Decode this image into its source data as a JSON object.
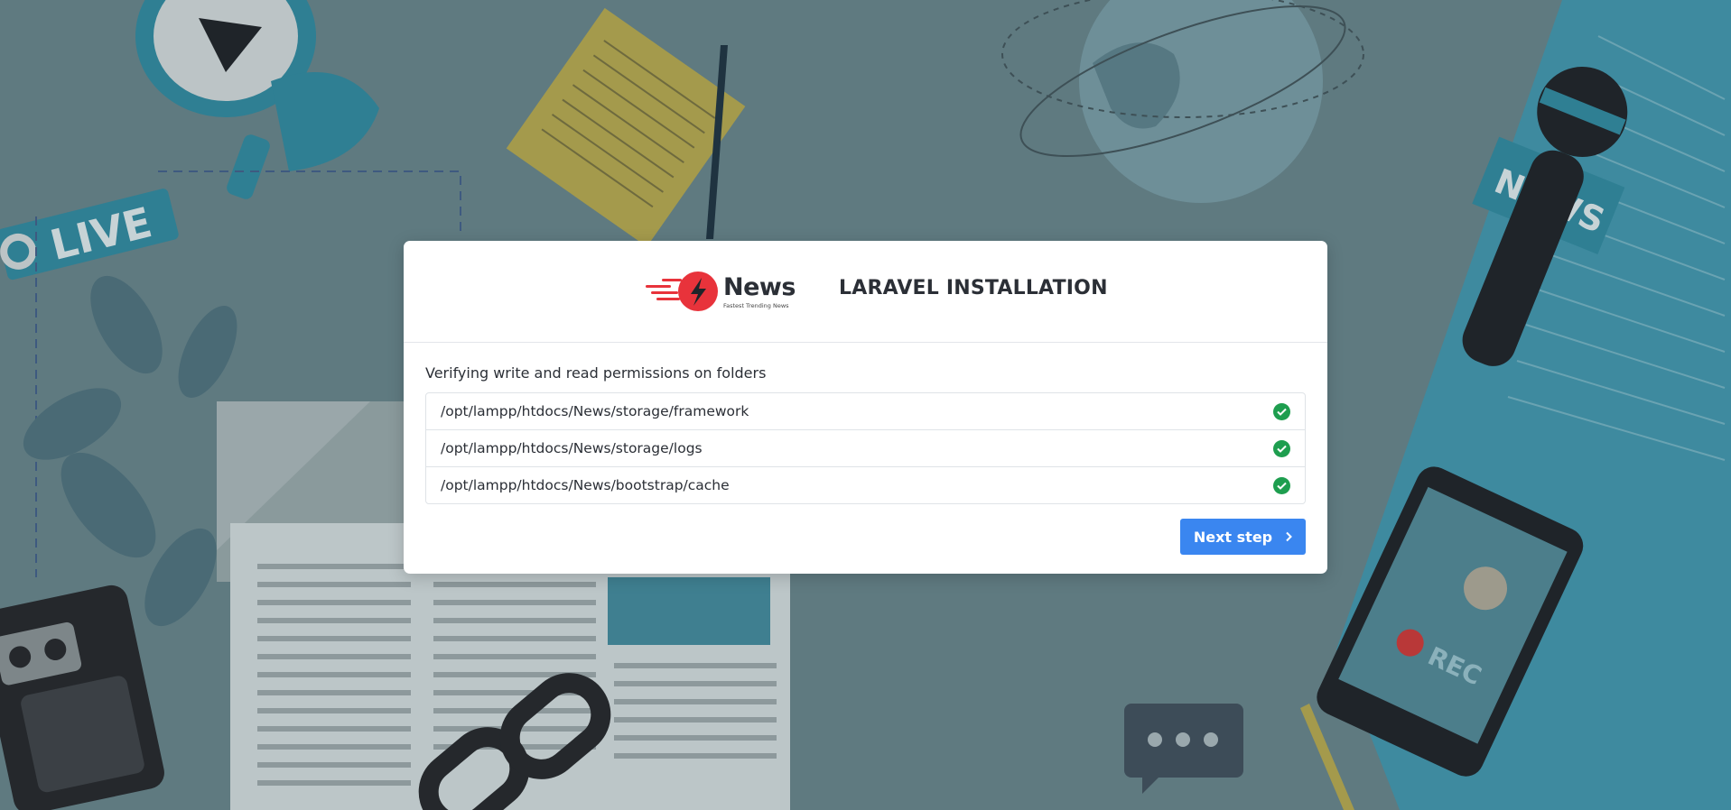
{
  "brand": {
    "name": "News",
    "tagline": "Fastest Trending News",
    "logo_icon": "lightning-bolt-icon",
    "accent_color": "#e8333b"
  },
  "installer": {
    "title": "LARAVEL INSTALLATION",
    "intro": "Verifying write and read permissions on folders",
    "folders": [
      {
        "path": "/opt/lampp/htdocs/News/storage/framework",
        "status_icon": "check-circle-icon",
        "status_color": "#1e9e4f"
      },
      {
        "path": "/opt/lampp/htdocs/News/storage/logs",
        "status_icon": "check-circle-icon",
        "status_color": "#1e9e4f"
      },
      {
        "path": "/opt/lampp/htdocs/News/bootstrap/cache",
        "status_icon": "check-circle-icon",
        "status_color": "#1e9e4f"
      }
    ],
    "next_button": {
      "label": "Next step",
      "icon": "chevron-right-icon",
      "color": "#3a86f0"
    }
  },
  "background": {
    "badges": {
      "live": "LIVE",
      "news": "NEWS",
      "rec": "REC"
    }
  }
}
